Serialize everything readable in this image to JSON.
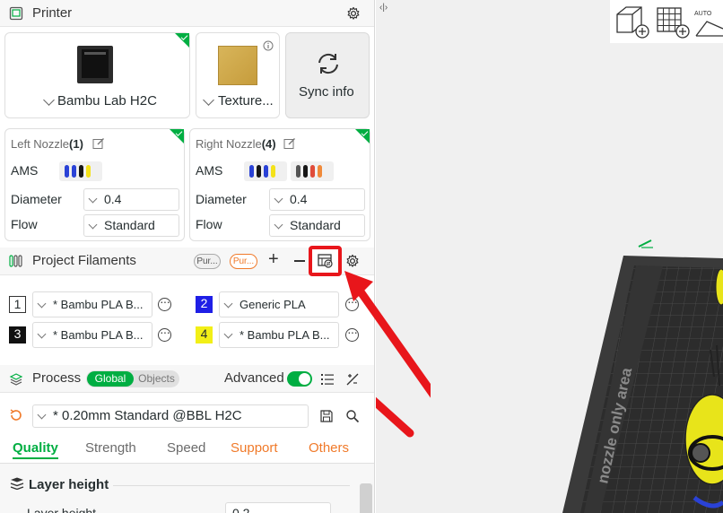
{
  "printer": {
    "title": "Printer",
    "printer_name": "Bambu Lab H2C",
    "plate_name": "Texture...",
    "sync_label": "Sync info"
  },
  "nozzles": {
    "left": {
      "title": "Left Nozzle",
      "count": "(1)",
      "ams_label": "AMS",
      "diameter_label": "Diameter",
      "diameter_value": "0.4",
      "flow_label": "Flow",
      "flow_value": "Standard"
    },
    "right": {
      "title": "Right Nozzle",
      "count": "(4)",
      "ams_label": "AMS",
      "diameter_label": "Diameter",
      "diameter_value": "0.4",
      "flow_label": "Flow",
      "flow_value": "Standard"
    }
  },
  "filaments": {
    "title": "Project Filaments",
    "pill_1": "Pur...",
    "pill_2": "Pur...",
    "items": [
      {
        "num": "1",
        "name": "* Bambu PLA B...",
        "color": "#ffffff"
      },
      {
        "num": "2",
        "name": "Generic PLA",
        "color": "#1f1fe6"
      },
      {
        "num": "3",
        "name": "* Bambu PLA B...",
        "color": "#111111"
      },
      {
        "num": "4",
        "name": "* Bambu PLA B...",
        "color": "#f2ef17"
      }
    ]
  },
  "process": {
    "title": "Process",
    "toggle_global": "Global",
    "toggle_objects": "Objects",
    "advanced_label": "Advanced",
    "preset": "* 0.20mm Standard @BBL H2C",
    "tabs": [
      "Quality",
      "Strength",
      "Speed",
      "Support",
      "Others"
    ],
    "section_title": "Layer height",
    "row_label": "Layer height",
    "row_value": "0.2"
  },
  "viewport": {
    "plate_text": "nozzle only area",
    "auto_label": "AUTO"
  },
  "colors": {
    "accent": "#00ae42",
    "warning": "#f07a2a",
    "highlight": "#e8161b"
  }
}
